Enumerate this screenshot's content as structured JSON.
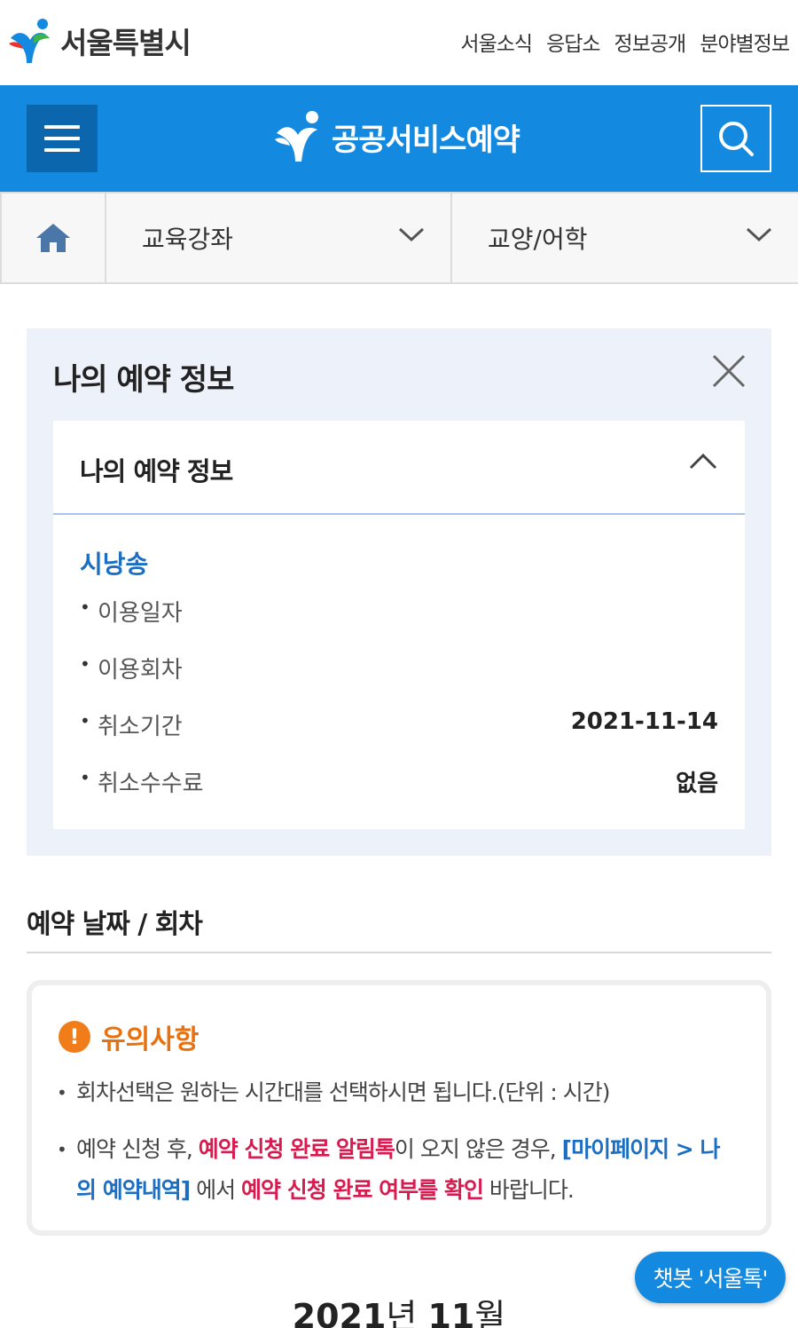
{
  "header": {
    "logo_text": "서울특별시",
    "links": [
      "서울소식",
      "응답소",
      "정보공개",
      "분야별정보"
    ]
  },
  "bluebar": {
    "brand_text": "공공서비스예약",
    "color": "#1489e0"
  },
  "nav": {
    "category": "교육강좌",
    "subcategory": "교양/어학"
  },
  "reservation_panel": {
    "title": "나의 예약 정보",
    "card_title": "나의 예약 정보",
    "program_name": "시낭송",
    "rows": [
      {
        "label": "이용일자",
        "value": ""
      },
      {
        "label": "이용회차",
        "value": ""
      },
      {
        "label": "취소기간",
        "value": "2021-11-14"
      },
      {
        "label": "취소수수료",
        "value": "없음"
      }
    ]
  },
  "section": {
    "title": "예약 날짜 / 회차"
  },
  "notice": {
    "title": "유의사항",
    "item1": "회차선택은 원하는 시간대를 선택하시면 됩니다.(단위 : 시간)",
    "item2_part1": "예약 신청 후, ",
    "item2_part2": "예약 신청 완료 알림톡",
    "item2_part3": "이 오지 않은 경우, ",
    "item2_part4": "[마이페이지 > 나의 예약내역]",
    "item2_part5": " 에서 ",
    "item2_part6": "예약 신청 완료 여부를 확인",
    "item2_part7": " 바랍니다."
  },
  "calendar": {
    "year": "2021",
    "year_suffix": "년 ",
    "month": "11",
    "month_suffix": "월"
  },
  "chatbot": {
    "label": "챗봇 '서울톡'"
  }
}
